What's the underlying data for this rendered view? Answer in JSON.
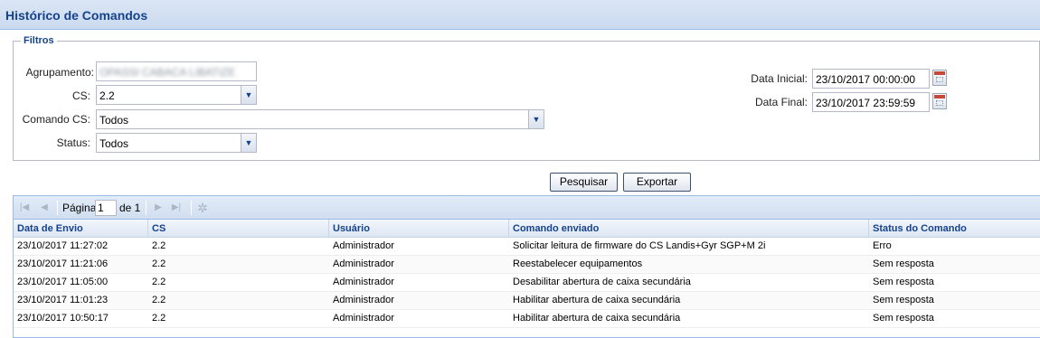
{
  "header": {
    "title": "Histórico de Comandos"
  },
  "filters": {
    "legend": "Filtros",
    "agrupamento_label": "Agrupamento:",
    "agrupamento_value": "OPASSI CABACA LIBATIZE",
    "cs_label": "CS:",
    "cs_value": "2.2",
    "comando_label": "Comando CS:",
    "comando_value": "Todos",
    "status_label": "Status:",
    "status_value": "Todos",
    "data_inicial_label": "Data Inicial:",
    "data_inicial_value": "23/10/2017 00:00:00",
    "data_final_label": "Data Final:",
    "data_final_value": "23/10/2017 23:59:59"
  },
  "actions": {
    "search_label": "Pesquisar",
    "export_label": "Exportar"
  },
  "pager": {
    "page_label": "Página",
    "page_value": "1",
    "of_label": "de 1"
  },
  "grid": {
    "columns": [
      "Data de Envio",
      "CS",
      "Usuário",
      "Comando enviado",
      "Status do Comando"
    ],
    "rows": [
      [
        "23/10/2017 11:27:02",
        "2.2",
        "Administrador",
        "Solicitar leitura de firmware do CS Landis+Gyr SGP+M 2i",
        "Erro"
      ],
      [
        "23/10/2017 11:21:06",
        "2.2",
        "Administrador",
        "Reestabelecer equipamentos",
        "Sem resposta"
      ],
      [
        "23/10/2017 11:05:00",
        "2.2",
        "Administrador",
        "Desabilitar abertura de caixa secundária",
        "Sem resposta"
      ],
      [
        "23/10/2017 11:01:23",
        "2.2",
        "Administrador",
        "Habilitar abertura de caixa secundária",
        "Sem resposta"
      ],
      [
        "23/10/2017 10:50:17",
        "2.2",
        "Administrador",
        "Habilitar abertura de caixa secundária",
        "Sem resposta"
      ]
    ]
  },
  "colors": {
    "header_text": "#15428b",
    "grid_border": "#99bbe8",
    "panel_bg": "#dfe8f6"
  }
}
